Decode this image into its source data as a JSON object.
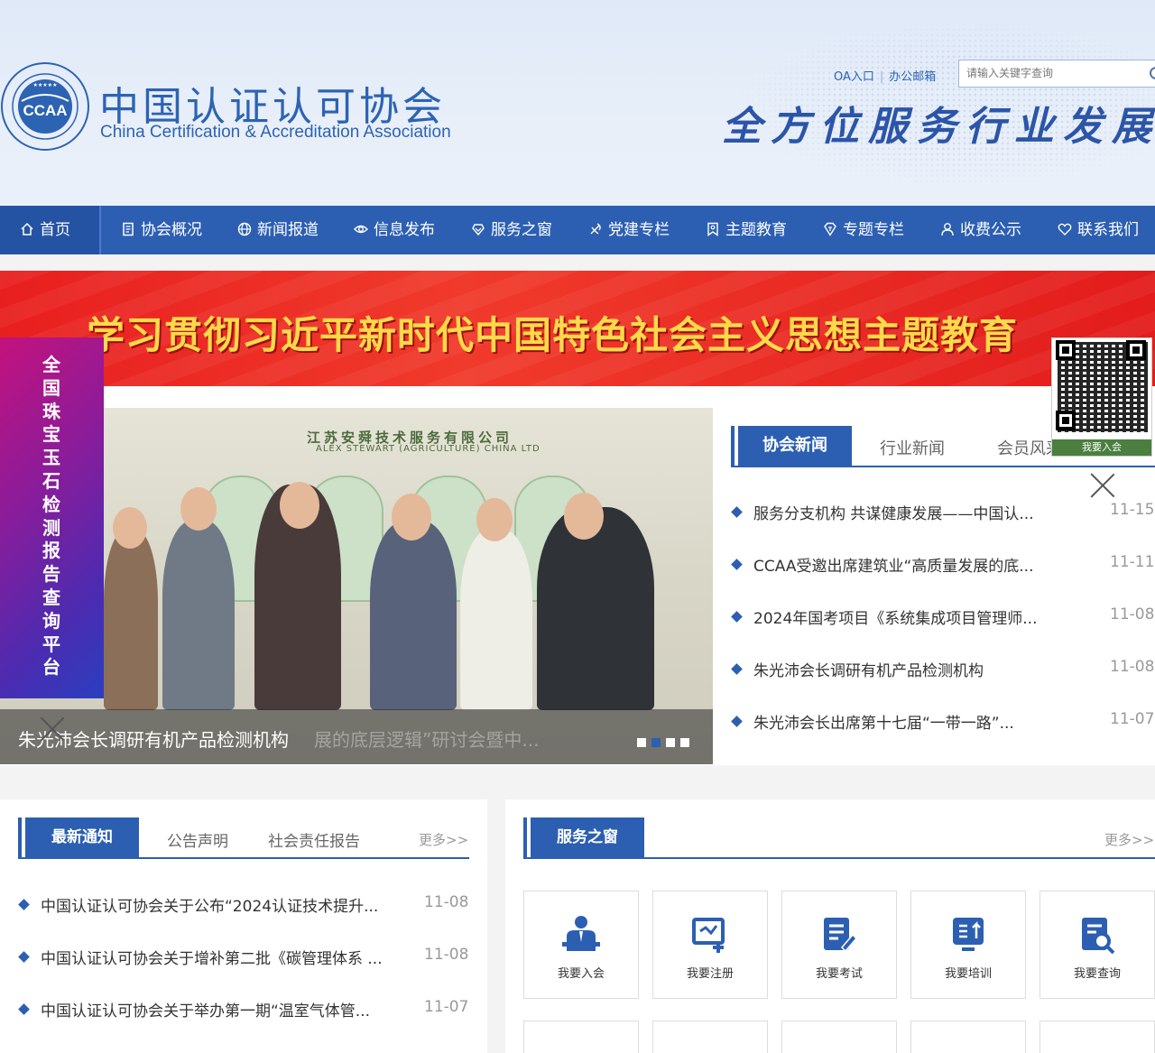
{
  "header": {
    "org_name_cn": "中国认证认可协会",
    "org_name_en": "China Certification & Accreditation Association",
    "logo_text": "CCAA",
    "top_links": [
      "OA入口",
      "办公邮箱"
    ],
    "search_placeholder": "请输入关键字查询",
    "slogan": "全方位服务行业发展"
  },
  "nav": {
    "items": [
      {
        "label": "首页",
        "icon": "home-icon"
      },
      {
        "label": "协会概况",
        "icon": "document-icon"
      },
      {
        "label": "新闻报道",
        "icon": "globe-icon"
      },
      {
        "label": "信息发布",
        "icon": "eye-icon"
      },
      {
        "label": "服务之窗",
        "icon": "service-icon"
      },
      {
        "label": "党建专栏",
        "icon": "party-icon"
      },
      {
        "label": "主题教育",
        "icon": "bookmark-icon"
      },
      {
        "label": "专题专栏",
        "icon": "tag-icon"
      },
      {
        "label": "收费公示",
        "icon": "user-icon"
      },
      {
        "label": "联系我们",
        "icon": "heart-icon"
      }
    ]
  },
  "banner": {
    "text": "学习贯彻习近平新时代中国特色社会主义思想主题教育"
  },
  "side_ad": {
    "text": "全国珠宝玉石检测报告查询平台"
  },
  "slider": {
    "wall_title": "江苏安舜技术服务有限公司",
    "wall_subtitle": "ALEX STEWART (AGRICULTURE) CHINA LTD",
    "caption": "朱光沛会长调研有机产品检测机构",
    "caption_overlap": "展的底层逻辑”研讨会暨中...",
    "dots": 4,
    "active_dot": 1
  },
  "news": {
    "tabs": [
      "协会新闻",
      "行业新闻",
      "会员风采"
    ],
    "active_tab": 0,
    "items": [
      {
        "title": "服务分支机构 共谋健康发展——中国认...",
        "date": "11-15"
      },
      {
        "title": "CCAA受邀出席建筑业“高质量发展的底...",
        "date": "11-11"
      },
      {
        "title": "2024年国考项目《系统集成项目管理师...",
        "date": "11-08"
      },
      {
        "title": "朱光沛会长调研有机产品检测机构",
        "date": "11-08"
      },
      {
        "title": "朱光沛会长出席第十七届“一带一路”...",
        "date": "11-07"
      }
    ]
  },
  "qr": {
    "label": "我要入会"
  },
  "notices": {
    "tabs": [
      "最新通知",
      "公告声明",
      "社会责任报告"
    ],
    "more": "更多>>",
    "items": [
      {
        "title": "中国认证认可协会关于公布“2024认证技术提升...",
        "date": "11-08"
      },
      {
        "title": "中国认证认可协会关于增补第二批《碳管理体系 ...",
        "date": "11-08"
      },
      {
        "title": "中国认证认可协会关于举办第一期“温室气体管...",
        "date": "11-07"
      }
    ]
  },
  "services": {
    "title": "服务之窗",
    "more": "更多>>",
    "items": [
      {
        "label": "我要入会",
        "icon": "member-icon"
      },
      {
        "label": "我要注册",
        "icon": "register-icon"
      },
      {
        "label": "我要考试",
        "icon": "exam-icon"
      },
      {
        "label": "我要培训",
        "icon": "training-icon"
      },
      {
        "label": "我要查询",
        "icon": "query-icon"
      }
    ]
  },
  "colors": {
    "primary": "#2c5fb2",
    "banner_red": "#e81f1f",
    "banner_text": "#ffd94a"
  }
}
